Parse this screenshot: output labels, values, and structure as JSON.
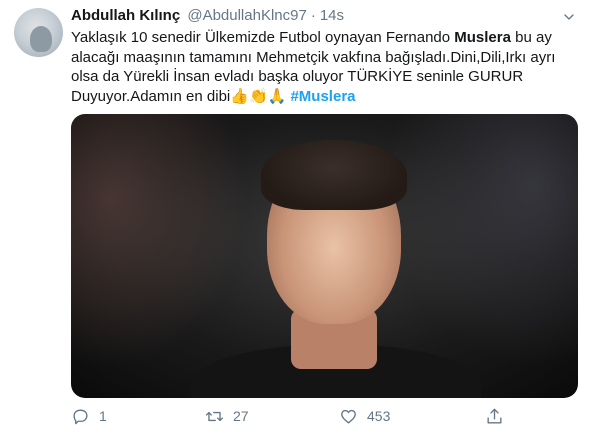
{
  "tweet": {
    "author_name": "Abdullah Kılınç",
    "handle": "@AbdullahKlnc97",
    "separator": "·",
    "time": "14s",
    "text_part1": "Yaklaşık 10 senedir Ülkemizde Futbol oynayan Fernando ",
    "text_bold": "Muslera",
    "text_part2": " bu ay alacağı maaşının tamamını Mehmetçik vakfına bağışladı.Dini,Dili,Irkı ayrı olsa da Yürekli İnsan evladı başka oluyor TÜRKİYE seninle GURUR Duyuyor.Adamın en dibi",
    "emojis": "👍👏🙏",
    "hashtag": "#Muslera"
  },
  "actions": {
    "reply_count": "1",
    "retweet_count": "27",
    "like_count": "453"
  },
  "icons": {
    "reply": "reply-icon",
    "retweet": "retweet-icon",
    "like": "heart-icon",
    "share": "share-icon",
    "more": "chevron-down-icon"
  },
  "colors": {
    "accent": "#1da1f2",
    "muted": "#657786",
    "text": "#14171a"
  }
}
